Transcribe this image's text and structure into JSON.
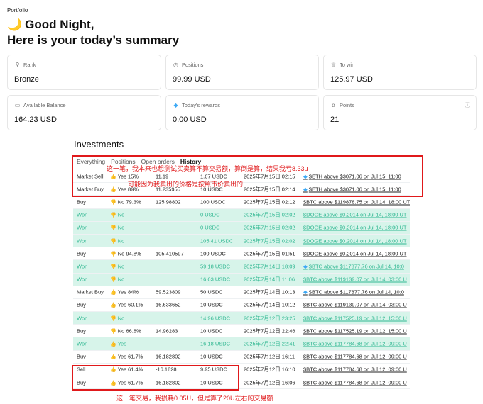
{
  "breadcrumb": "Portfolio",
  "greeting": {
    "line1": "Good Night,",
    "line2": "Here is your today’s summary"
  },
  "cards": {
    "rank": {
      "label": "Rank",
      "value": "Bronze",
      "icon": "rank-icon"
    },
    "positions": {
      "label": "Positions",
      "value": "99.99 USD",
      "icon": "clock-icon"
    },
    "to_win": {
      "label": "To win",
      "value": "125.97 USD",
      "icon": "trophy-icon"
    },
    "available_balance": {
      "label": "Available Balance",
      "value": "164.23 USD",
      "icon": "wallet-icon"
    },
    "todays_rewards": {
      "label": "Today's rewards",
      "value": "0.00 USD",
      "icon": "diamond-icon"
    },
    "points": {
      "label": "Points",
      "value": "21",
      "icon": "alpha-icon",
      "info_icon": "info-icon"
    }
  },
  "investments": {
    "title": "Investments",
    "tabs": [
      "Everything",
      "Positions",
      "Open orders",
      "History"
    ],
    "active_tab": "History",
    "rows": [
      {
        "type": "Market Sell",
        "side": "Yes 15%",
        "shares": "11.19",
        "amount": "1.67 USDC",
        "time": "2025年7月15日 02:15",
        "market": "$ETH above $3071.06 on Jul 15, 11:00",
        "won": false,
        "thumb": "up",
        "gem": true
      },
      {
        "type": "Market Buy",
        "side": "Yes 89%",
        "shares": "11.235955",
        "amount": "10 USDC",
        "time": "2025年7月15日 02:14",
        "market": "$ETH above $3071.06 on Jul 15, 11:00",
        "won": false,
        "thumb": "up",
        "gem": true
      },
      {
        "type": "Buy",
        "side": "No 79.3%",
        "shares": "125.98802",
        "amount": "100 USDC",
        "time": "2025年7月15日 02:12",
        "market": "$BTC above $119878.75 on Jul 14, 18:00 UT",
        "won": false,
        "thumb": "down",
        "gem": false
      },
      {
        "type": "Won",
        "side": "No",
        "shares": "",
        "amount": "0 USDC",
        "time": "2025年7月15日 02:02",
        "market": "$DOGE above $0.2014 on Jul 14, 18:00 UT",
        "won": true,
        "thumb": "down",
        "gem": false
      },
      {
        "type": "Won",
        "side": "No",
        "shares": "",
        "amount": "0 USDC",
        "time": "2025年7月15日 02:02",
        "market": "$DOGE above $0.2014 on Jul 14, 18:00 UT",
        "won": true,
        "thumb": "down",
        "gem": false
      },
      {
        "type": "Won",
        "side": "No",
        "shares": "",
        "amount": "105.41 USDC",
        "time": "2025年7月15日 02:02",
        "market": "$DOGE above $0.2014 on Jul 14, 18:00 UT",
        "won": true,
        "thumb": "down",
        "gem": false
      },
      {
        "type": "Buy",
        "side": "No 94.8%",
        "shares": "105.410597",
        "amount": "100 USDC",
        "time": "2025年7月15日 01:51",
        "market": "$DOGE above $0.2014 on Jul 14, 18:00 UT",
        "won": false,
        "thumb": "down",
        "gem": false
      },
      {
        "type": "Won",
        "side": "No",
        "shares": "",
        "amount": "59.18 USDC",
        "time": "2025年7月14日 18:09",
        "market": "$BTC above $117877.76 on Jul 14, 10:0",
        "won": true,
        "thumb": "down",
        "gem": true
      },
      {
        "type": "Won",
        "side": "No",
        "shares": "",
        "amount": "16.63 USDC",
        "time": "2025年7月14日 11:06",
        "market": "$BTC above $119139.07 on Jul 14, 03:00 U",
        "won": true,
        "thumb": "down",
        "gem": false
      },
      {
        "type": "Market Buy",
        "side": "Yes 84%",
        "shares": "59.523809",
        "amount": "50 USDC",
        "time": "2025年7月14日 10:13",
        "market": "$BTC above $117877.76 on Jul 14, 10:0",
        "won": false,
        "thumb": "up",
        "gem": true
      },
      {
        "type": "Buy",
        "side": "Yes 60.1%",
        "shares": "16.633652",
        "amount": "10 USDC",
        "time": "2025年7月14日 10:12",
        "market": "$BTC above $119139.07 on Jul 14, 03:00 U",
        "won": false,
        "thumb": "up",
        "gem": false
      },
      {
        "type": "Won",
        "side": "No",
        "shares": "",
        "amount": "14.96 USDC",
        "time": "2025年7月12日 23:25",
        "market": "$BTC above $117525.19 on Jul 12, 15:00 U",
        "won": true,
        "thumb": "down",
        "gem": false
      },
      {
        "type": "Buy",
        "side": "No 66.8%",
        "shares": "14.96283",
        "amount": "10 USDC",
        "time": "2025年7月12日 22:46",
        "market": "$BTC above $117525.19 on Jul 12, 15:00 U",
        "won": false,
        "thumb": "down",
        "gem": false
      },
      {
        "type": "Won",
        "side": "Yes",
        "shares": "",
        "amount": "16.18 USDC",
        "time": "2025年7月12日 22:41",
        "market": "$BTC above $117784.68 on Jul 12, 09:00 U",
        "won": true,
        "thumb": "up",
        "gem": false
      },
      {
        "type": "Buy",
        "side": "Yes 61.7%",
        "shares": "16.182802",
        "amount": "10 USDC",
        "time": "2025年7月12日 16:11",
        "market": "$BTC above $117784.68 on Jul 12, 09:00 U",
        "won": false,
        "thumb": "up",
        "gem": false
      },
      {
        "type": "Sell",
        "side": "Yes 61.4%",
        "shares": "-16.1828",
        "amount": "9.95 USDC",
        "time": "2025年7月12日 16:10",
        "market": "$BTC above $117784.68 on Jul 12, 09:00 U",
        "won": false,
        "thumb": "up",
        "gem": false
      },
      {
        "type": "Buy",
        "side": "Yes 61.7%",
        "shares": "16.182802",
        "amount": "10 USDC",
        "time": "2025年7月12日 16:06",
        "market": "$BTC above $117784.68 on Jul 12, 09:00 U",
        "won": false,
        "thumb": "up",
        "gem": false
      }
    ]
  },
  "annotations": {
    "top_line1": "这一笔，我本来也想测试买卖算不算交易额，算倒是算，结果我亏8.33u",
    "top_line2": "可能因为我卖出的价格是按照市价卖出的",
    "bottom": "这一笔交易，我损耗0.05U，但是算了20U左右的交易额"
  },
  "colors": {
    "won_bg": "#d7f4ea",
    "won_text": "#2fb791",
    "annotation_red": "#e0191b",
    "gem_blue": "#3da9f5"
  }
}
